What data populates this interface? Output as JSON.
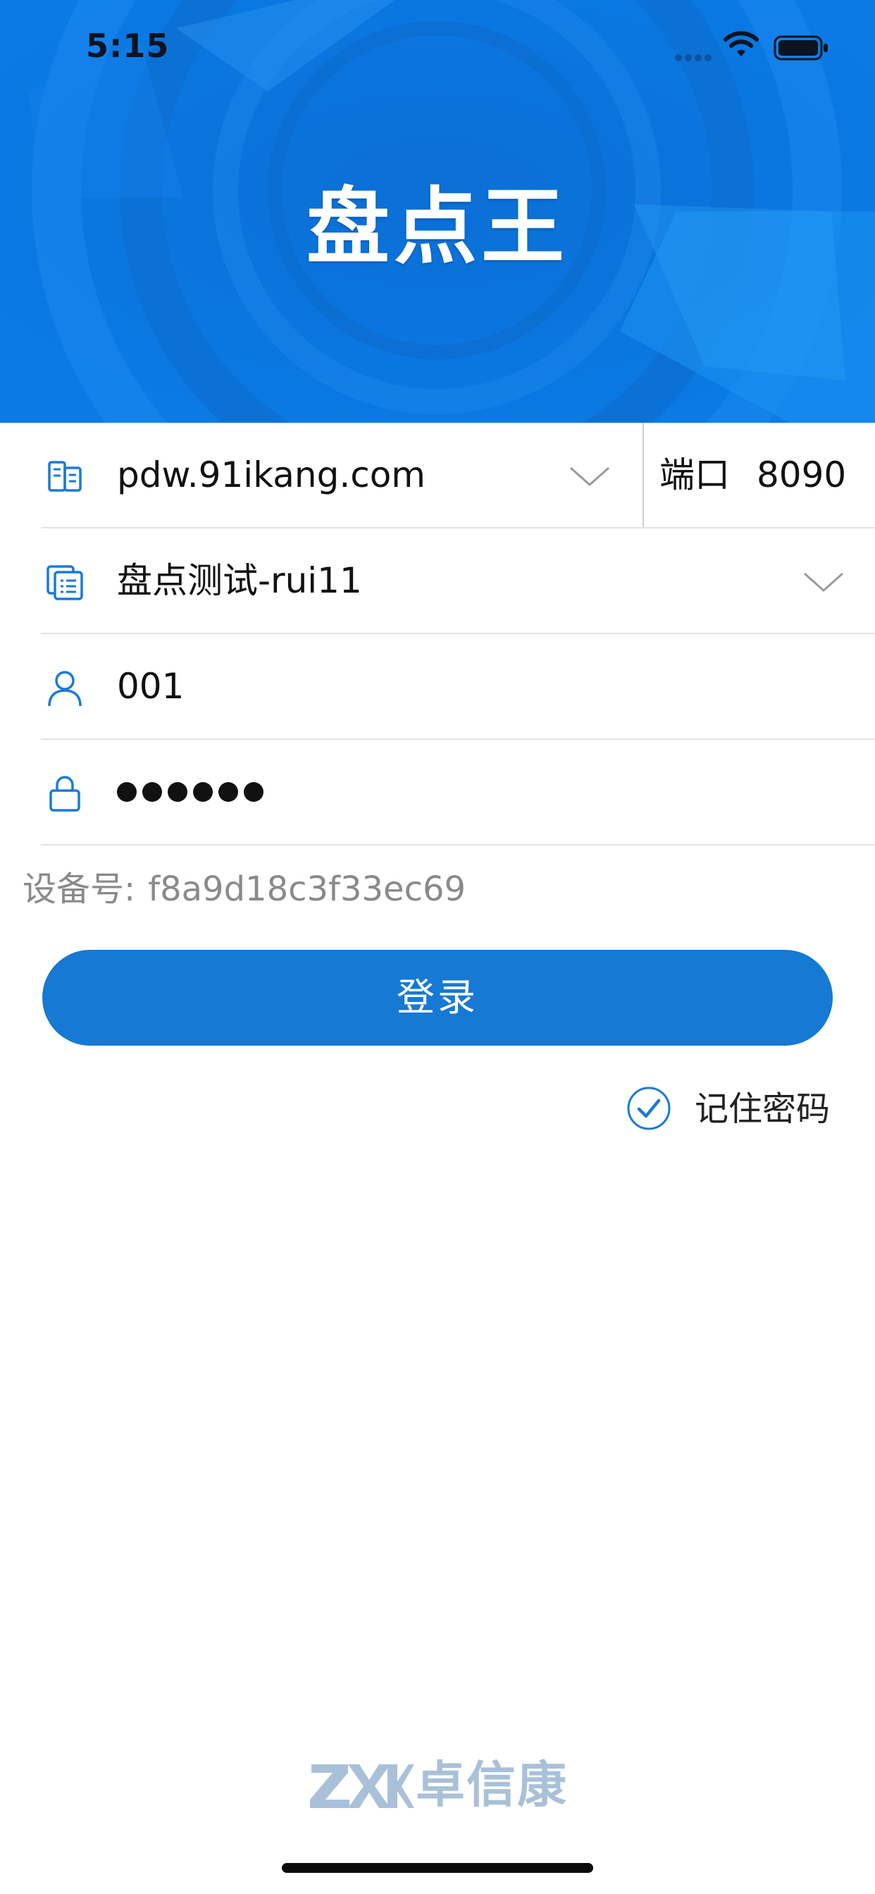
{
  "status_bar": {
    "time": "5:15"
  },
  "app": {
    "title": "盘点王"
  },
  "form": {
    "server": {
      "value": "pdw.91ikang.com"
    },
    "port": {
      "label": "端口",
      "value": "8090"
    },
    "database": {
      "value": "盘点测试-rui11"
    },
    "username": {
      "value": "001"
    },
    "password": {
      "masked_length": 6
    }
  },
  "device": {
    "label": "设备号:",
    "id": "f8a9d18c3f33ec69"
  },
  "login_button": {
    "label": "登录"
  },
  "remember_password": {
    "label": "记住密码",
    "checked": true
  },
  "footer": {
    "brand_name": "卓信康",
    "logo_text": "ZXK"
  },
  "colors": {
    "header_blue": "#0a78e0",
    "primary_button": "#1679d4",
    "icon_blue": "#1a7ad6",
    "brand_gray_blue": "#a9c1d8",
    "hint_gray": "#8a8a8a"
  },
  "icons": {
    "server": "server-icon",
    "database": "database-list-icon",
    "user": "user-icon",
    "lock": "lock-icon",
    "dropdown": "chevron-down-icon",
    "checkbox": "check-circle-icon"
  }
}
